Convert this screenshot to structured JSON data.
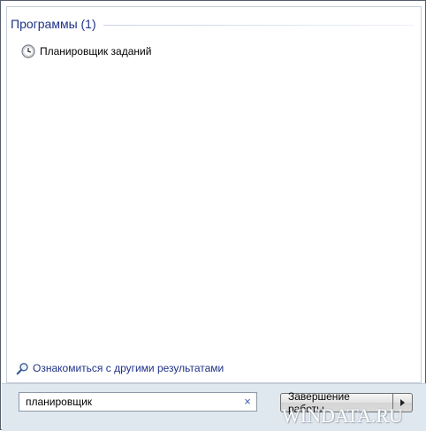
{
  "programs_section": {
    "title": "Программы (1)",
    "results": [
      {
        "label": "Планировщик заданий",
        "icon": "clock-icon"
      }
    ]
  },
  "more_results": {
    "label": "Ознакомиться с другими результатами",
    "icon": "magnifier-icon"
  },
  "search": {
    "value": "планировщик",
    "clear_glyph": "×"
  },
  "shutdown": {
    "label": "Завершение работы",
    "arrow_icon": "chevron-right-icon"
  },
  "watermark": "WINDATA.RU",
  "colors": {
    "accent_blue": "#1e3287",
    "bottom_band": "#dfe7ef"
  }
}
